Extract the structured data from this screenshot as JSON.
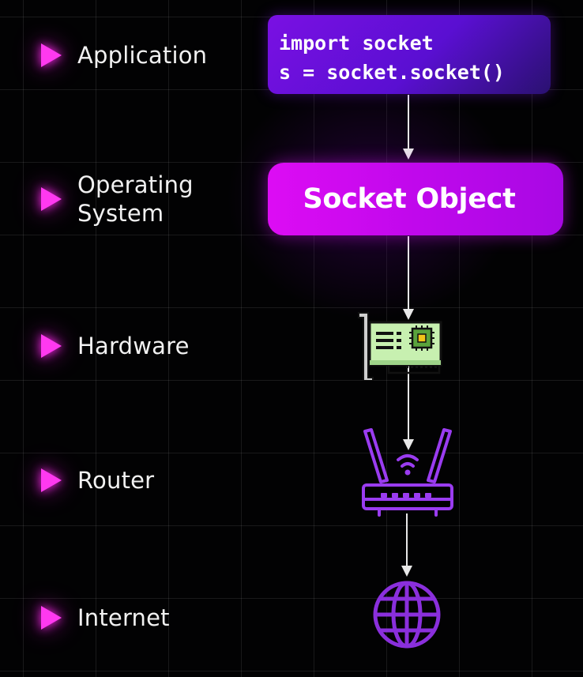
{
  "layers": [
    {
      "label": "Application"
    },
    {
      "label": "Operating\nSystem"
    },
    {
      "label": "Hardware"
    },
    {
      "label": "Router"
    },
    {
      "label": "Internet"
    }
  ],
  "code": {
    "line1": "import socket",
    "line2": "s = socket.socket()"
  },
  "socket_box": {
    "label": "Socket Object"
  },
  "icons": {
    "hardware": "network-card-icon",
    "router": "wifi-router-icon",
    "internet": "globe-icon"
  },
  "colors": {
    "accent": "#ff39f0",
    "code_bg": "#6a10de",
    "socket_bg": "#cc0af0",
    "router": "#a040f0",
    "globe": "#8a28d8"
  }
}
